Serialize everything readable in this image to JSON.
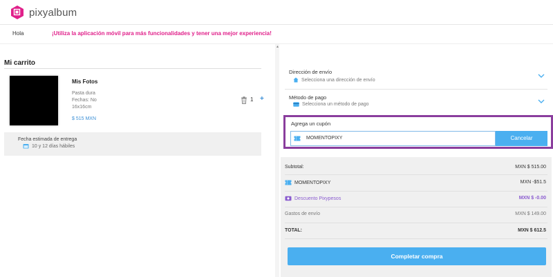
{
  "brand": {
    "name": "pixyalbum",
    "color": "#e0208a",
    "logo_icon": "pixyalbum-logo-icon"
  },
  "subbar": {
    "greeting": "Hola",
    "promo": "¡Utiliza la aplicación móvil para más funcionalidades y tener una mejor experiencia!"
  },
  "cart": {
    "title": "Mi carrito",
    "item": {
      "name": "Mis Fotos",
      "cover": "Pasta dura",
      "dates": "Fechas: No",
      "size": "16x16cm",
      "price": "$ 515 MXN",
      "quantity": "1",
      "plus": "+"
    },
    "delivery": {
      "label": "Fecha estimada de entrega",
      "value": "10 y 12 días hábiles"
    }
  },
  "checkout": {
    "shipping": {
      "title": "Dirección de envío",
      "placeholder": "Selecciona una dirección de envío"
    },
    "payment": {
      "title": "Método de pago",
      "placeholder": "Selecciona un método de pago"
    },
    "coupon": {
      "title": "Agrega un cupón",
      "value": "MOMENTOPIXY",
      "cancel_label": "Cancelar"
    },
    "summary": {
      "subtotal_label": "Subtotal:",
      "subtotal_value": "MXN $ 515.00",
      "coupon_label": "MOMENTOPIXY",
      "coupon_value": "MXN -$51.5",
      "pixypesos_label": "Descuento Pixypesos",
      "pixypesos_value": "MXN $ -0.00",
      "shipping_label": "Gastos de envío",
      "shipping_value": "MXN $ 149.00",
      "total_label": "TOTAL:",
      "total_value": "MXN $ 612.5"
    },
    "complete_label": "Completar compra"
  },
  "colors": {
    "accent_blue": "#4aaff0",
    "coupon_border": "#8a3d9d",
    "pixypesos": "#8a5bcf"
  }
}
